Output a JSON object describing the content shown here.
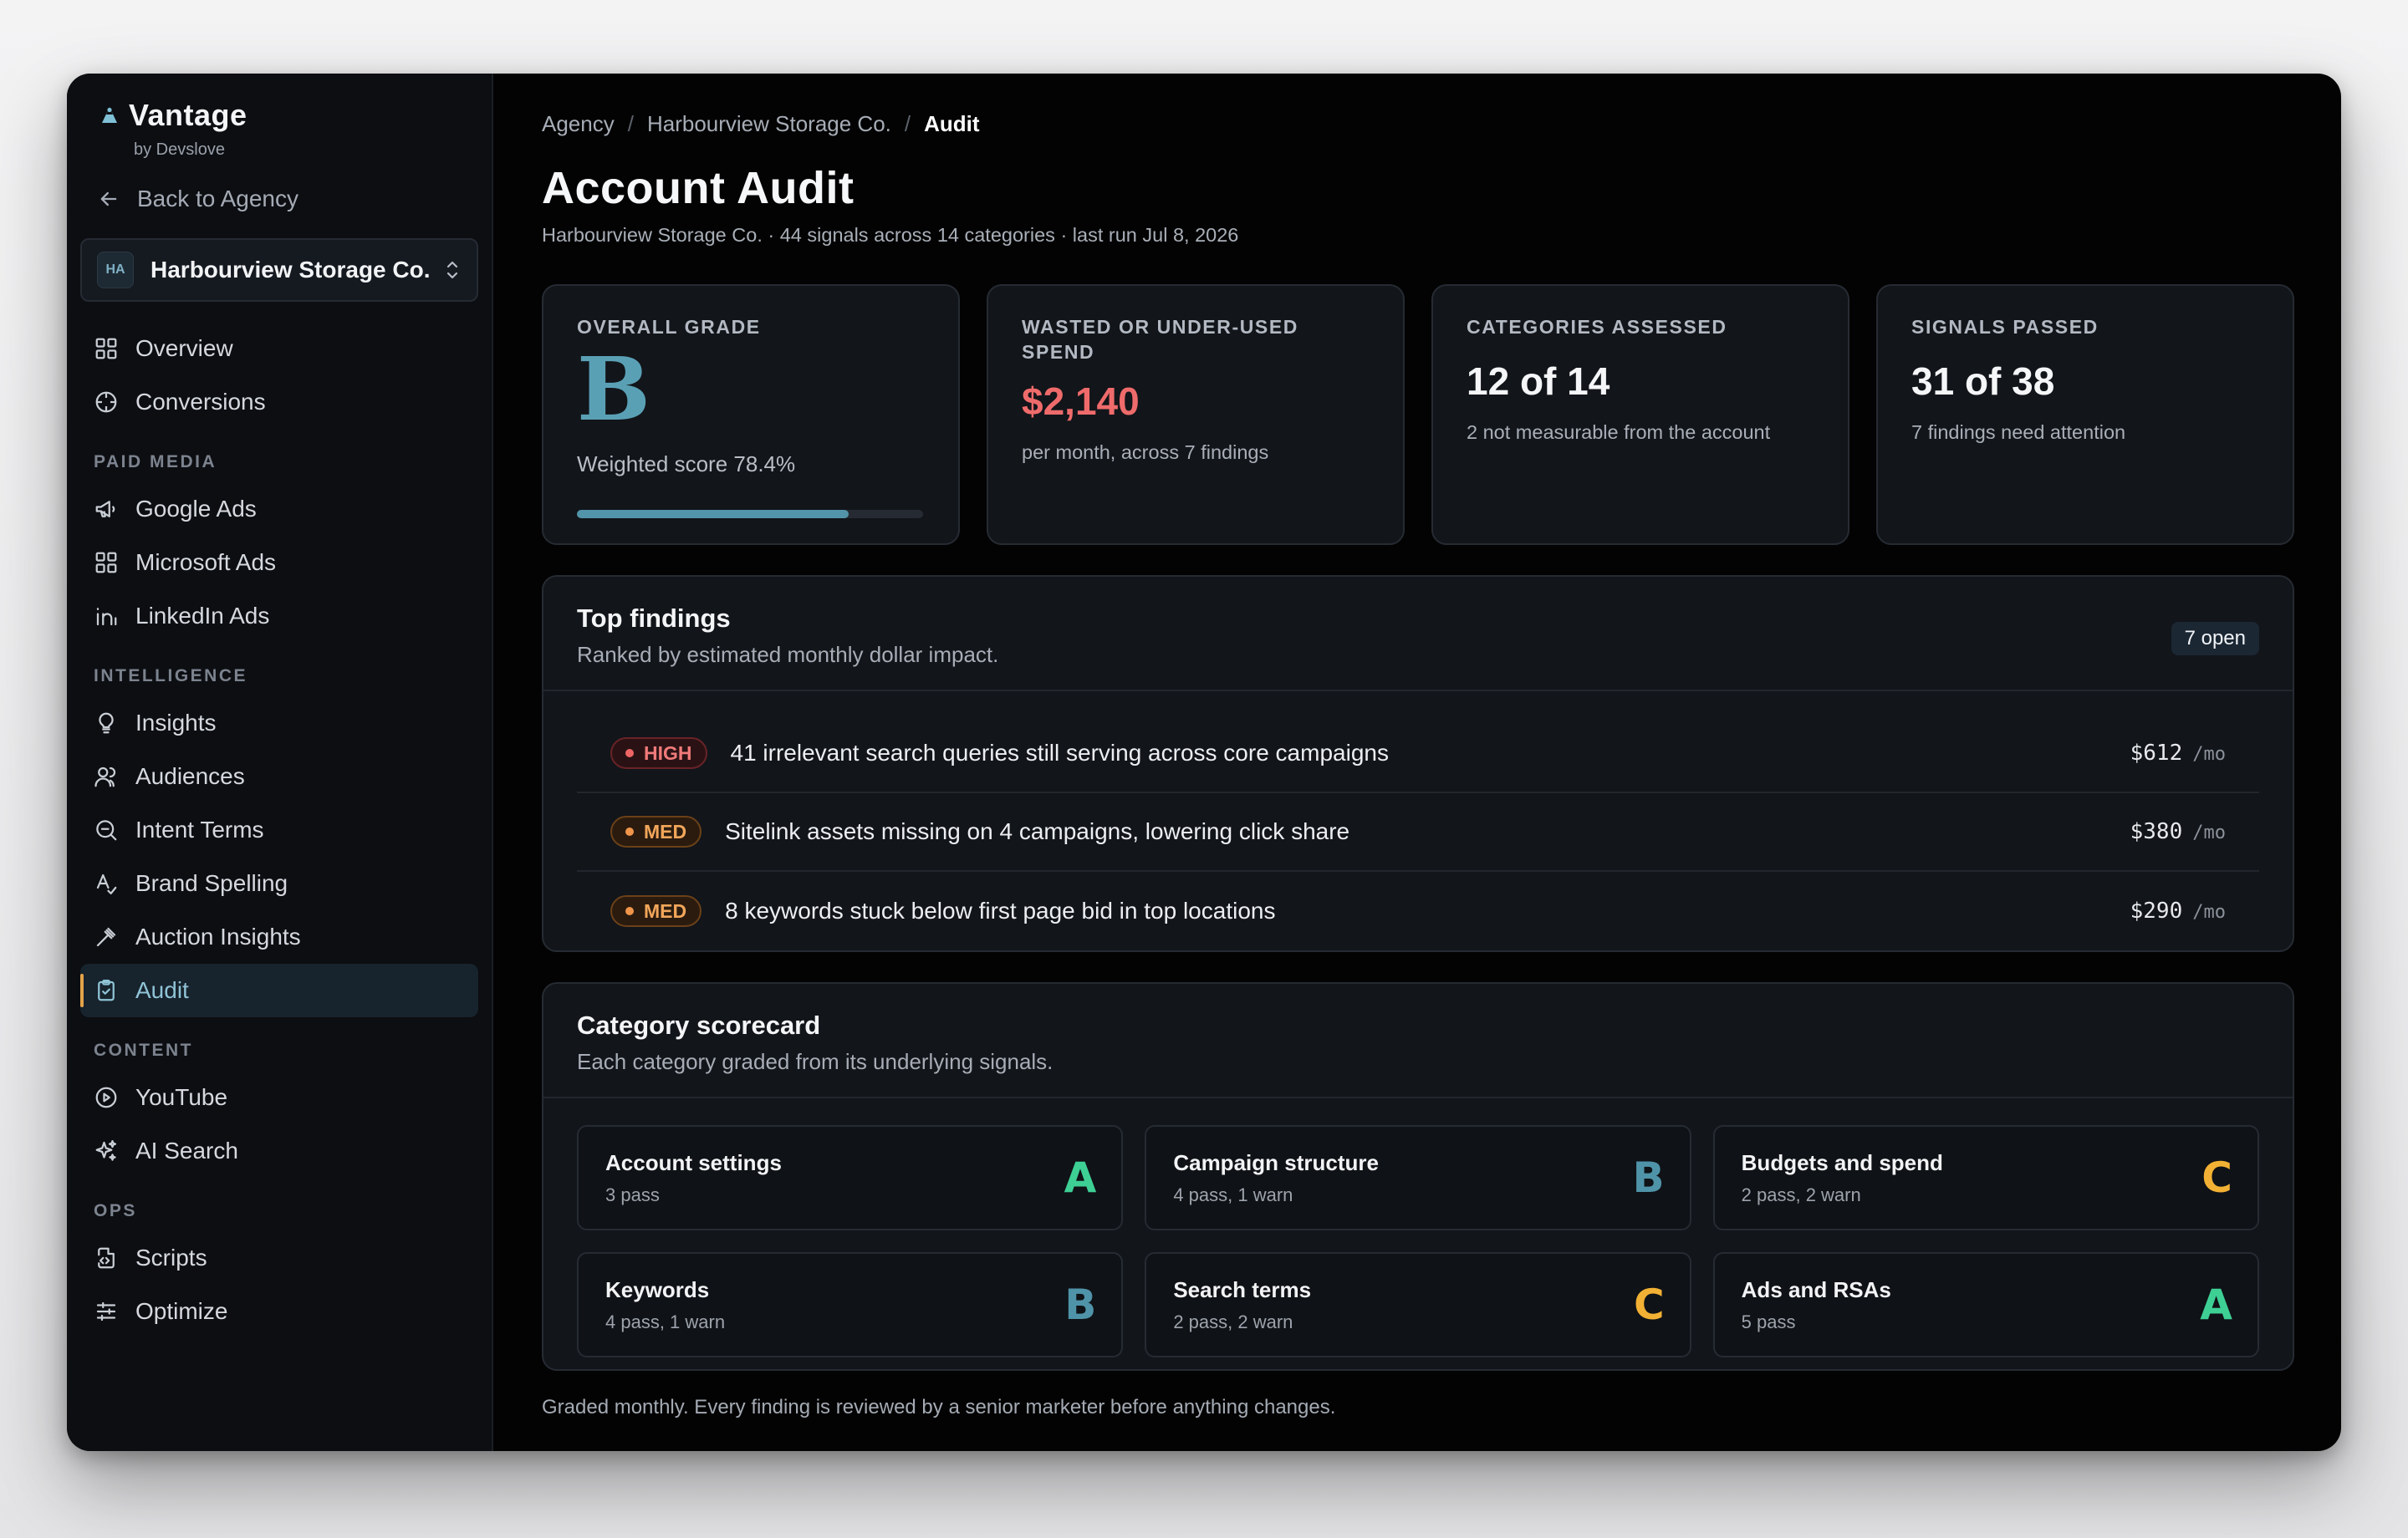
{
  "brand": {
    "name": "Vantage",
    "subtitle": "by Devslove"
  },
  "sidebar": {
    "back_label": "Back to Agency",
    "account": {
      "initials": "HA",
      "name": "Harbourview Storage Co."
    },
    "top_items": [
      {
        "label": "Overview",
        "icon": "grid-icon"
      },
      {
        "label": "Conversions",
        "icon": "target-icon"
      }
    ],
    "sections": [
      {
        "title": "PAID MEDIA",
        "items": [
          {
            "label": "Google Ads",
            "icon": "megaphone-icon"
          },
          {
            "label": "Microsoft Ads",
            "icon": "grid-icon"
          },
          {
            "label": "LinkedIn Ads",
            "icon": "linkedin-icon"
          }
        ]
      },
      {
        "title": "INTELLIGENCE",
        "items": [
          {
            "label": "Insights",
            "icon": "lightbulb-icon"
          },
          {
            "label": "Audiences",
            "icon": "users-icon"
          },
          {
            "label": "Intent Terms",
            "icon": "search-icon"
          },
          {
            "label": "Brand Spelling",
            "icon": "spell-icon"
          },
          {
            "label": "Auction Insights",
            "icon": "gavel-icon"
          },
          {
            "label": "Audit",
            "icon": "clipboard-check-icon",
            "active": true
          }
        ]
      },
      {
        "title": "CONTENT",
        "items": [
          {
            "label": "YouTube",
            "icon": "play-circle-icon"
          },
          {
            "label": "AI Search",
            "icon": "sparkles-icon"
          }
        ]
      },
      {
        "title": "OPS",
        "items": [
          {
            "label": "Scripts",
            "icon": "file-code-icon"
          },
          {
            "label": "Optimize",
            "icon": "sliders-icon"
          }
        ]
      }
    ]
  },
  "breadcrumb": {
    "items": [
      "Agency",
      "Harbourview Storage Co."
    ],
    "current": "Audit"
  },
  "header": {
    "title": "Account Audit",
    "subtitle": "Harbourview Storage Co. · 44 signals across 14 categories · last run Jul 8, 2026"
  },
  "stats": {
    "grade": {
      "label": "OVERALL GRADE",
      "value": "B",
      "weighted": "Weighted score 78.4%",
      "score_fraction": 0.784
    },
    "wasted": {
      "label": "WASTED OR UNDER-USED SPEND",
      "value": "$2,140",
      "note": "per month, across 7 findings"
    },
    "categories": {
      "label": "CATEGORIES ASSESSED",
      "value": "12 of 14",
      "note": "2 not measurable from the account"
    },
    "signals": {
      "label": "SIGNALS PASSED",
      "value": "31 of 38",
      "note": "7 findings need attention"
    }
  },
  "findings": {
    "title": "Top findings",
    "subtitle": "Ranked by estimated monthly dollar impact.",
    "badge": "7 open",
    "per_label": "/mo",
    "items": [
      {
        "severity": "HIGH",
        "text": "41 irrelevant search queries still serving across core campaigns",
        "amount": "$612"
      },
      {
        "severity": "MED",
        "text": "Sitelink assets missing on 4 campaigns, lowering click share",
        "amount": "$380"
      },
      {
        "severity": "MED",
        "text": "8 keywords stuck below first page bid in top locations",
        "amount": "$290"
      }
    ]
  },
  "scorecard": {
    "title": "Category scorecard",
    "subtitle": "Each category graded from its underlying signals.",
    "grade_colors": {
      "A": "#3ecf95",
      "B": "#4f93a9",
      "C": "#f2b134"
    },
    "items": [
      {
        "name": "Account settings",
        "detail": "3 pass",
        "grade": "A"
      },
      {
        "name": "Campaign structure",
        "detail": "4 pass, 1 warn",
        "grade": "B"
      },
      {
        "name": "Budgets and spend",
        "detail": "2 pass, 2 warn",
        "grade": "C"
      },
      {
        "name": "Keywords",
        "detail": "4 pass, 1 warn",
        "grade": "B"
      },
      {
        "name": "Search terms",
        "detail": "2 pass, 2 warn",
        "grade": "C"
      },
      {
        "name": "Ads and RSAs",
        "detail": "5 pass",
        "grade": "A"
      }
    ]
  },
  "footer": {
    "note": "Graded monthly. Every finding is reviewed by a senior marketer before anything changes."
  }
}
